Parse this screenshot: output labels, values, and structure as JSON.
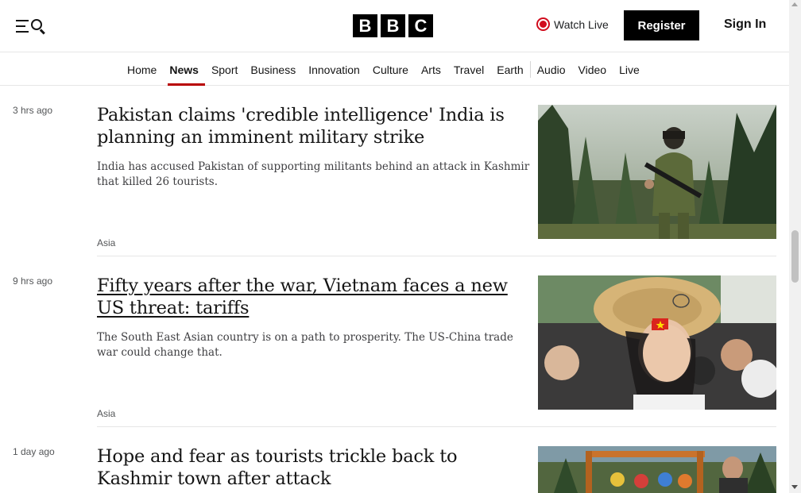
{
  "header": {
    "menu_icon": "menu-search-icon",
    "logo": [
      "B",
      "B",
      "C"
    ],
    "watch_live": "Watch Live",
    "register": "Register",
    "sign_in": "Sign In"
  },
  "nav": {
    "items": [
      "Home",
      "News",
      "Sport",
      "Business",
      "Innovation",
      "Culture",
      "Arts",
      "Travel",
      "Earth",
      "Audio",
      "Video",
      "Live"
    ],
    "active": "News"
  },
  "articles": [
    {
      "time": "3 hrs ago",
      "headline": "Pakistan claims 'credible intelligence' India is planning an imminent military strike",
      "summary": "India has accused Pakistan of supporting militants behind an attack in Kashmir that killed 26 tourists.",
      "tag": "Asia",
      "image": "soldier-in-forest-photo"
    },
    {
      "time": "9 hrs ago",
      "headline": "Fifty years after the war, Vietnam faces a new US threat: tariffs",
      "summary": "The South East Asian country is on a path to prosperity. The US-China trade war could change that.",
      "tag": "Asia",
      "image": "woman-with-vietnam-flag-photo"
    },
    {
      "time": "1 day ago",
      "headline": "Hope and fear as tourists trickle back to Kashmir town after attack",
      "summary": "",
      "tag": "",
      "image": "pahalgam-sign-photo"
    }
  ],
  "colors": {
    "accent": "#b80000",
    "live": "#d10c1d",
    "text": "#141414"
  }
}
